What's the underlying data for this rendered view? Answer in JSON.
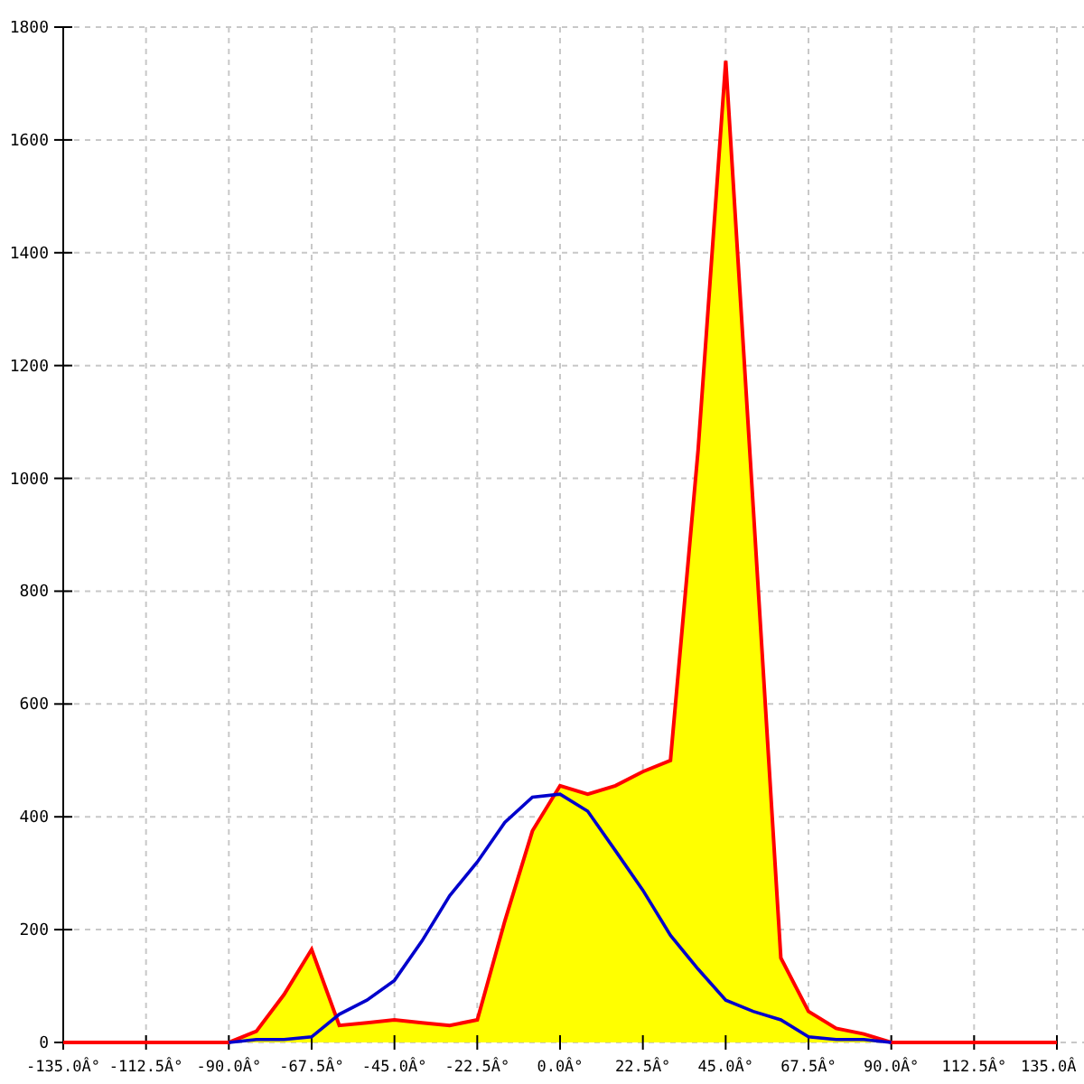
{
  "chart_data": {
    "type": "area",
    "x": [
      -135,
      -127.5,
      -120,
      -112.5,
      -105,
      -97.5,
      -90,
      -82.5,
      -75,
      -67.5,
      -60,
      -52.5,
      -45,
      -37.5,
      -30,
      -22.5,
      -15,
      -7.5,
      0,
      7.5,
      15,
      22.5,
      30,
      37.5,
      45,
      52.5,
      60,
      67.5,
      75,
      82.5,
      90,
      97.5,
      105,
      112.5,
      120,
      127.5,
      135
    ],
    "series": [
      {
        "type": "area",
        "color": "#ff0000",
        "values": [
          0,
          0,
          0,
          0,
          0,
          0,
          0,
          20,
          85,
          165,
          30,
          35,
          40,
          35,
          30,
          40,
          215,
          375,
          455,
          440,
          455,
          480,
          500,
          1050,
          1740,
          950,
          150,
          55,
          25,
          15,
          0,
          0,
          0,
          0,
          0,
          0,
          0
        ]
      },
      {
        "type": "line",
        "color": "#0000cc",
        "values": [
          null,
          null,
          null,
          null,
          null,
          null,
          0,
          5,
          5,
          10,
          50,
          75,
          110,
          180,
          260,
          320,
          390,
          435,
          440,
          410,
          340,
          270,
          190,
          130,
          75,
          55,
          40,
          10,
          5,
          5,
          0,
          null,
          null,
          null,
          null,
          null,
          null
        ]
      }
    ],
    "xlim": [
      -135,
      135
    ],
    "ylim": [
      0,
      1800
    ],
    "xticks": [
      {
        "value": -135,
        "label": "-135.0Â°"
      },
      {
        "value": -112.5,
        "label": "-112.5Â°"
      },
      {
        "value": -90,
        "label": "-90.0Â°"
      },
      {
        "value": -67.5,
        "label": "-67.5Â°"
      },
      {
        "value": -45,
        "label": "-45.0Â°"
      },
      {
        "value": -22.5,
        "label": "-22.5Â°"
      },
      {
        "value": 0,
        "label": "0.0Â°"
      },
      {
        "value": 22.5,
        "label": "22.5Â°"
      },
      {
        "value": 45,
        "label": "45.0Â°"
      },
      {
        "value": 67.5,
        "label": "67.5Â°"
      },
      {
        "value": 90,
        "label": "90.0Â°"
      },
      {
        "value": 112.5,
        "label": "112.5Â°"
      },
      {
        "value": 135,
        "label": "135.0Â"
      }
    ],
    "grid": true,
    "yticks": [
      0,
      200,
      400,
      600,
      800,
      1000,
      1200,
      1400,
      1600,
      1800
    ]
  }
}
